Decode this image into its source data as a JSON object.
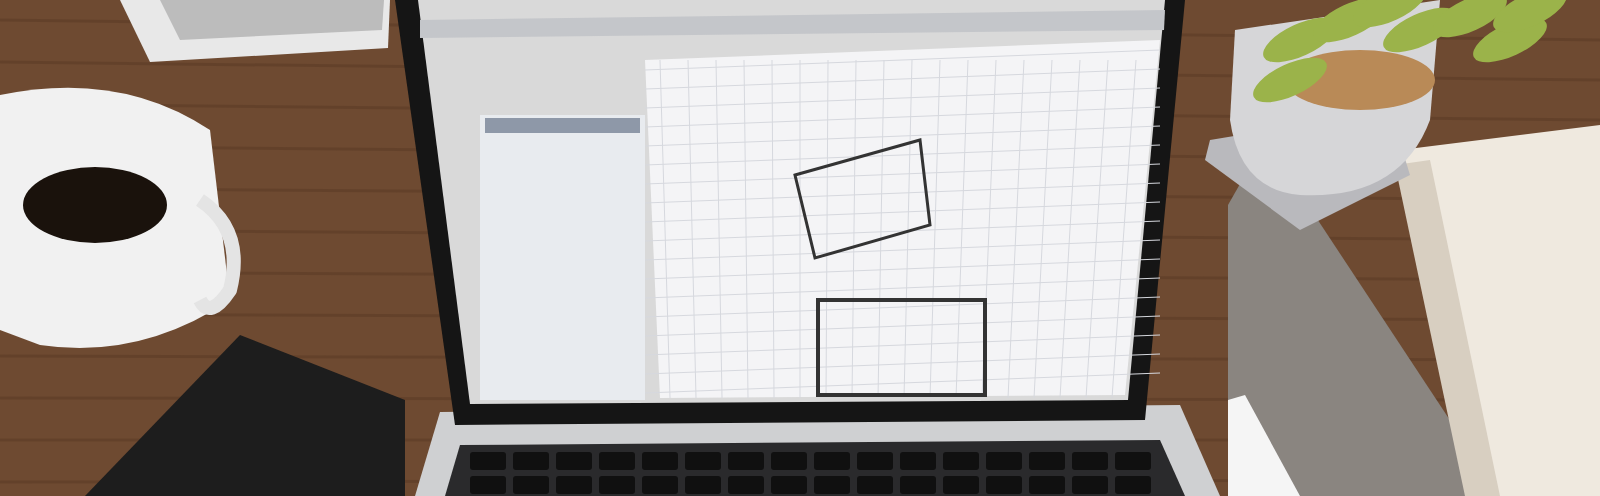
{
  "photo": {
    "kind": "desk-scene"
  }
}
